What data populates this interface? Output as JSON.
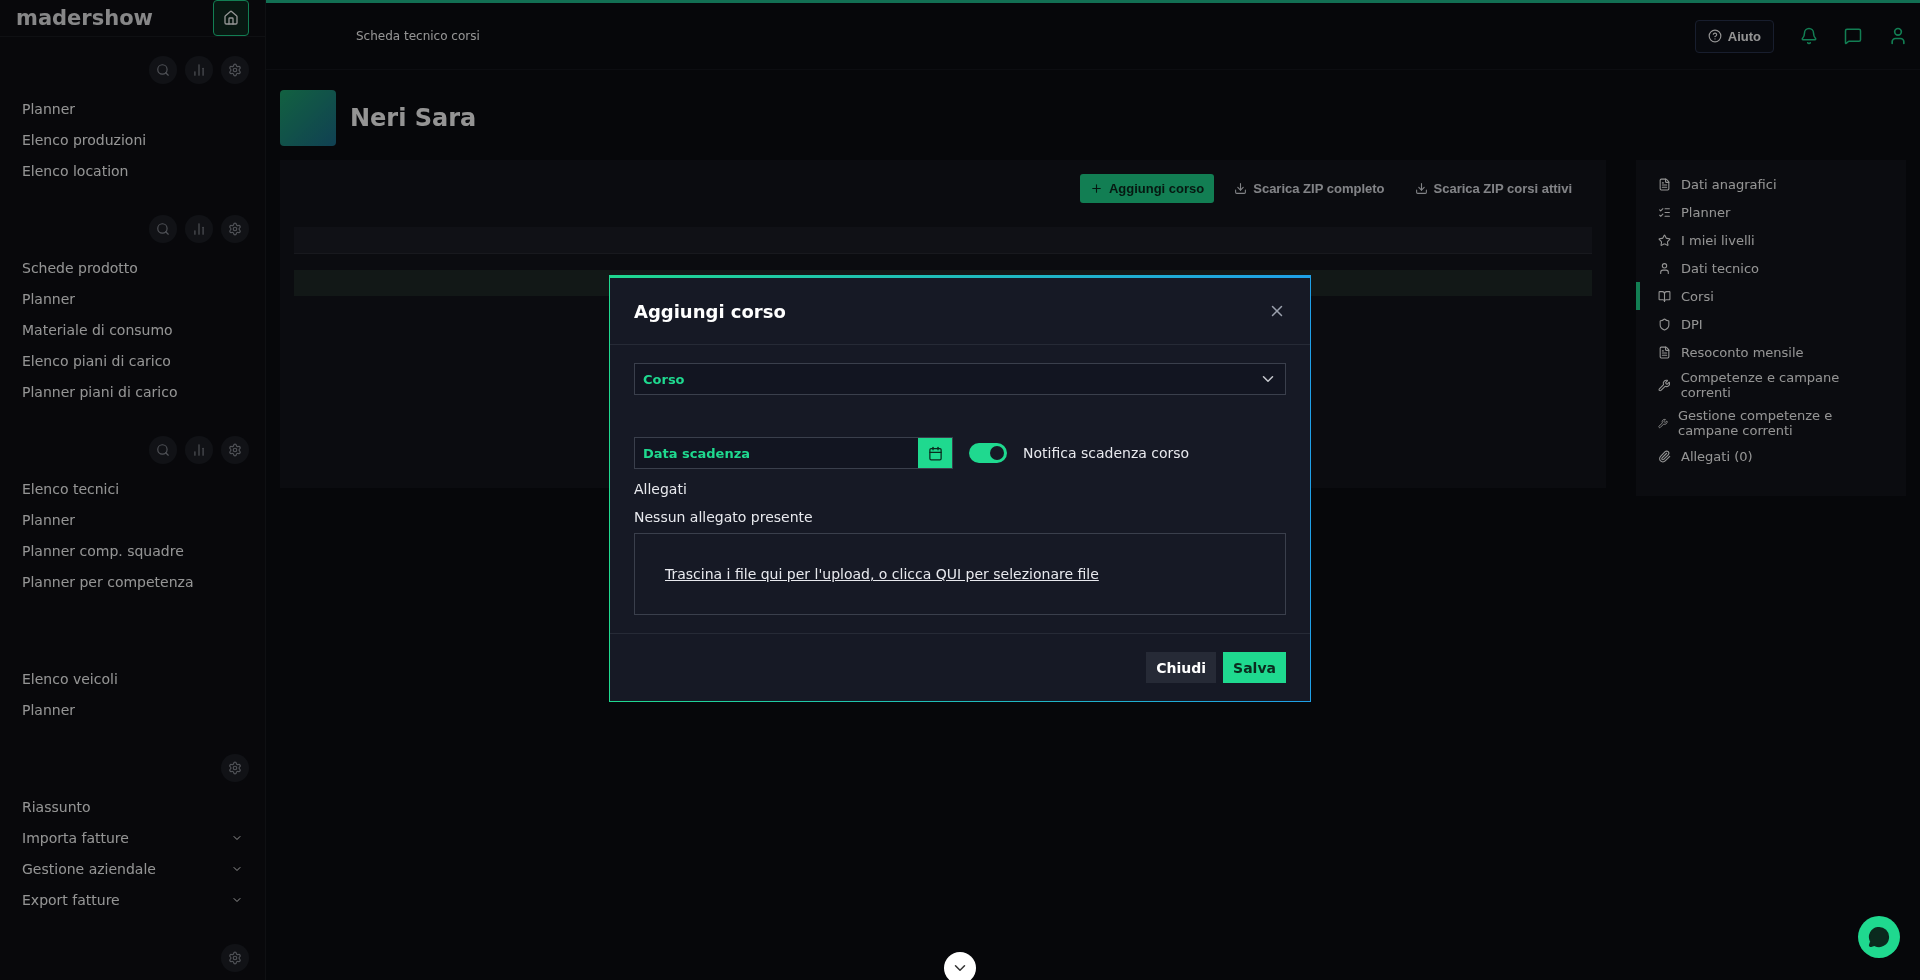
{
  "sidebar": {
    "brand": "madershow",
    "sections": [
      {
        "kind": "tools",
        "items": [
          {
            "label": "Planner",
            "expandable": false
          },
          {
            "label": "Elenco produzioni",
            "expandable": false
          },
          {
            "label": "Elenco location",
            "expandable": false
          }
        ]
      },
      {
        "kind": "tools",
        "items": [
          {
            "label": "Schede prodotto",
            "expandable": false
          },
          {
            "label": "Planner",
            "expandable": false
          },
          {
            "label": "Materiale di consumo",
            "expandable": false
          },
          {
            "label": "Elenco piani di carico",
            "expandable": false
          },
          {
            "label": "Planner piani di carico",
            "expandable": false
          }
        ]
      },
      {
        "kind": "tools",
        "items": [
          {
            "label": "Elenco tecnici",
            "expandable": false
          },
          {
            "label": "Planner",
            "expandable": false
          },
          {
            "label": "Planner comp. squadre",
            "expandable": false
          },
          {
            "label": "Planner per competenza",
            "expandable": false
          }
        ]
      },
      {
        "kind": "plain",
        "items": [
          {
            "label": "Elenco veicoli",
            "expandable": false
          },
          {
            "label": "Planner",
            "expandable": false
          }
        ]
      },
      {
        "kind": "single",
        "items": [
          {
            "label": "Riassunto",
            "expandable": false
          },
          {
            "label": "Importa fatture",
            "expandable": true
          },
          {
            "label": "Gestione aziendale",
            "expandable": true
          },
          {
            "label": "Export fatture",
            "expandable": true
          }
        ]
      },
      {
        "kind": "single"
      }
    ]
  },
  "topbar": {
    "breadcrumb": "Scheda tecnico corsi",
    "help": "Aiuto"
  },
  "profile": {
    "name": "Neri Sara"
  },
  "actions": [
    {
      "label": "Aggiungi corso",
      "kind": "primary"
    },
    {
      "label": "Scarica ZIP completo",
      "kind": "secondary"
    },
    {
      "label": "Scarica ZIP corsi attivi",
      "kind": "secondary"
    }
  ],
  "right_menu": [
    {
      "label": "Dati anagrafici",
      "selected": false
    },
    {
      "label": "Planner",
      "selected": false
    },
    {
      "label": "I miei livelli",
      "selected": false
    },
    {
      "label": "Dati tecnico",
      "selected": false
    },
    {
      "label": "Corsi",
      "selected": true
    },
    {
      "label": "DPI",
      "selected": false
    },
    {
      "label": "Resoconto mensile",
      "selected": false
    },
    {
      "label": "Competenze e campane correnti",
      "selected": false
    },
    {
      "label": "Gestione competenze e campane correnti",
      "selected": false
    },
    {
      "label": "Allegati (0)",
      "selected": false
    }
  ],
  "modal": {
    "title": "Aggiungi corso",
    "select_label": "Corso",
    "date_placeholder": "Data scadenza",
    "toggle": {
      "label": "Notifica scadenza corso",
      "on": true
    },
    "attachments_label": "Allegati",
    "empty": "Nessun allegato presente",
    "dropzone": "Trascina i file qui per l'upload, o clicca QUI per selezionare file",
    "buttons": [
      {
        "label": "Chiudi",
        "kind": "secondary"
      },
      {
        "label": "Salva",
        "kind": "primary"
      }
    ]
  }
}
